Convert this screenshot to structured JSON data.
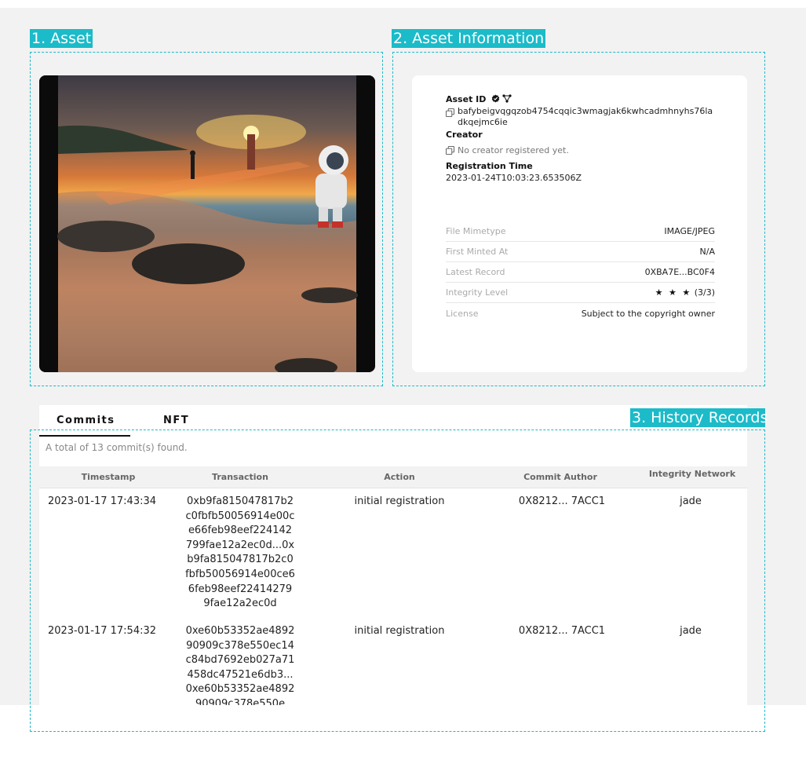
{
  "sections": {
    "asset": "1. Asset",
    "info": "2. Asset Information",
    "history": "3. History Records"
  },
  "info": {
    "asset_id_label": "Asset ID",
    "asset_id_value": "bafybeigvqgqzob4754cqqic3wmagjak6kwhcadmhnyhs76ladkqejmc6ie",
    "creator_label": "Creator",
    "creator_value": "No creator registered yet.",
    "reg_time_label": "Registration Time",
    "reg_time_value": "2023-01-24T10:03:23.653506Z",
    "props": [
      {
        "key": "File Mimetype",
        "value": "IMAGE/JPEG"
      },
      {
        "key": "First Minted At",
        "value": "N/A"
      },
      {
        "key": "Latest Record",
        "value": "0XBA7E...BC0F4"
      },
      {
        "key": "Integrity Level",
        "value": "★ ★ ★",
        "extra": "(3/3)"
      },
      {
        "key": "License",
        "value": "Subject to the copyright owner"
      }
    ]
  },
  "history": {
    "tabs": [
      "Commits",
      "NFT"
    ],
    "total": "A total of 13 commit(s) found.",
    "columns": [
      "Timestamp",
      "Transaction",
      "Action",
      "Commit Author",
      "Integrity Network"
    ],
    "rows": [
      {
        "timestamp": "2023-01-17 17:43:34",
        "transaction": "0xb9fa815047817b2c0fbfb50056914e00ce66feb98eef224142799fae12a2ec0d...0xb9fa815047817b2c0fbfb50056914e00ce66feb98eef224142799fae12a2ec0d",
        "action": "initial registration",
        "author": "0X8212... 7ACC1",
        "network": "jade"
      },
      {
        "timestamp": "2023-01-17 17:54:32",
        "transaction": "0xe60b53352ae489290909c378e550ec14c84bd7692eb027a71458dc47521e6db3...0xe60b53352ae489290909c378e550e",
        "action": "initial registration",
        "author": "0X8212... 7ACC1",
        "network": "jade"
      }
    ]
  },
  "colors": {
    "accent": "#1bbbc9",
    "background": "#f2f2f2"
  }
}
